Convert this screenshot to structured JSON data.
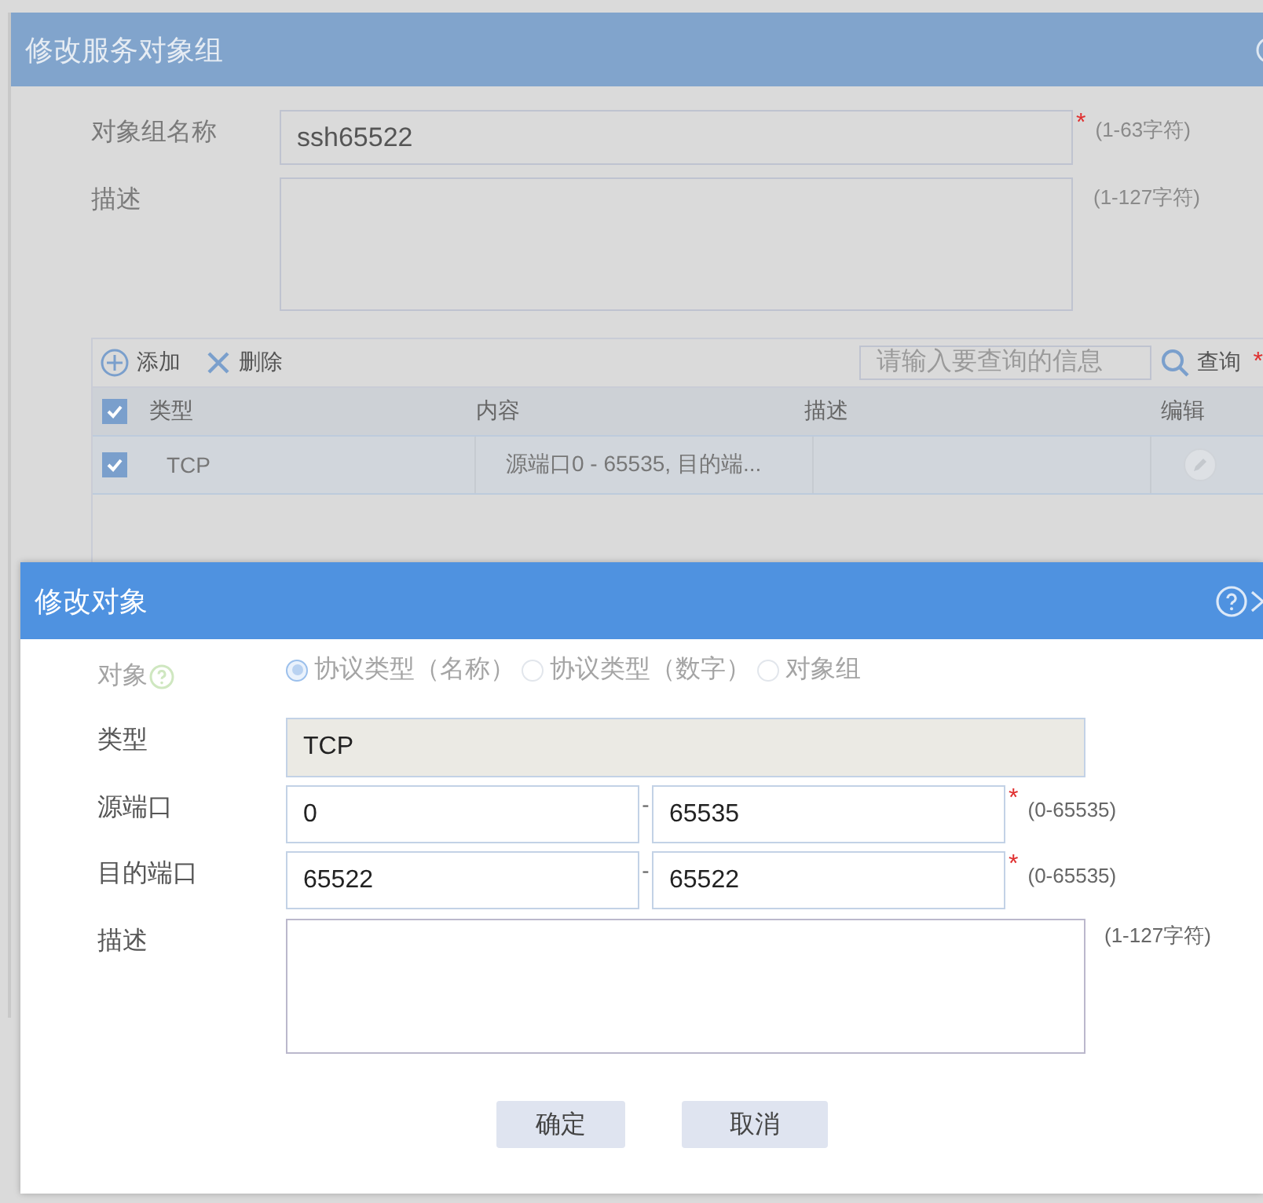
{
  "back_dialog": {
    "title": "修改服务对象组",
    "fields": [
      {
        "kind": "input",
        "label": "对象组名称",
        "value": "ssh65522",
        "required_mark": "*",
        "hint": "(1-63字符)"
      },
      {
        "kind": "textarea",
        "label": "描述",
        "hint": "(1-127字符)"
      }
    ],
    "toolbar": {
      "add": "添加",
      "delete": "删除",
      "search_placeholder": "请输入要查询的信息",
      "search": "查询",
      "required_mark": "*"
    },
    "table": {
      "all_checked": true,
      "columns": [
        "类型",
        "内容",
        "描述",
        "编辑"
      ],
      "rows": [
        {
          "checked": true,
          "type": "TCP",
          "content": "源端口0 - 65535, 目的端..."
        }
      ]
    }
  },
  "modal": {
    "title": "修改对象",
    "object_row": {
      "label": "对象",
      "disabled": true,
      "options": [
        {
          "label": "协议类型（名称）",
          "selected": true
        },
        {
          "label": "协议类型（数字）",
          "selected": false
        },
        {
          "label": "对象组",
          "selected": false
        }
      ]
    },
    "fields": [
      {
        "kind": "readonly",
        "label": "类型",
        "value": "TCP"
      },
      {
        "kind": "range",
        "label": "源端口",
        "from": "0",
        "separator": "-",
        "to": "65535",
        "required_mark": "*",
        "hint": "(0-65535)"
      },
      {
        "kind": "range",
        "label": "目的端口",
        "from": "65522",
        "separator": "-",
        "to": "65522",
        "required_mark": "*",
        "hint": "(0-65535)"
      },
      {
        "kind": "textarea",
        "label": "描述",
        "hint": "(1-127字符)"
      }
    ],
    "buttons": [
      "确定",
      "取消"
    ]
  }
}
